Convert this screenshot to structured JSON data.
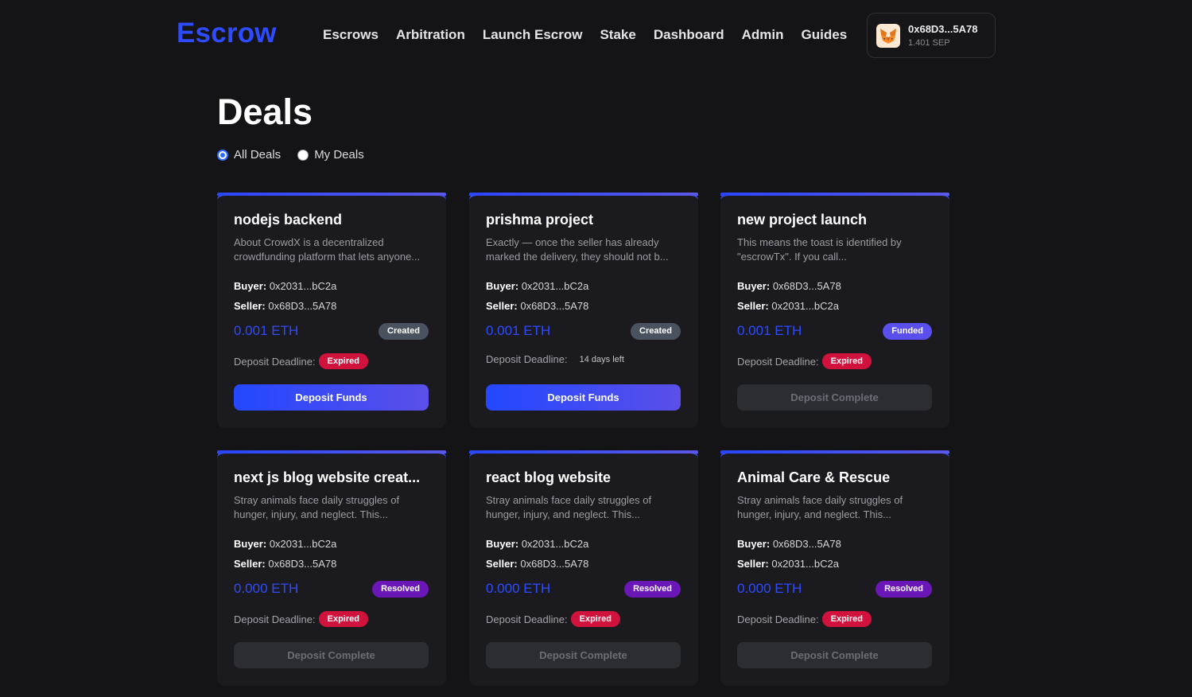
{
  "header": {
    "logo": "Escrow",
    "nav": [
      "Escrows",
      "Arbitration",
      "Launch Escrow",
      "Stake",
      "Dashboard",
      "Admin",
      "Guides"
    ],
    "wallet": {
      "address": "0x68D3...5A78",
      "balance": "1.401 SEP",
      "icon": "metamask-fox-icon"
    }
  },
  "page": {
    "title": "Deals",
    "filters": [
      {
        "label": "All Deals",
        "checked": true
      },
      {
        "label": "My Deals",
        "checked": false
      }
    ]
  },
  "labels": {
    "buyer": "Buyer:",
    "seller": "Seller:",
    "deadline": "Deposit Deadline:"
  },
  "cards": [
    {
      "title": "nodejs backend",
      "description": "About CrowdX is a decentralized crowdfunding platform that lets anyone...",
      "buyer": "0x2031...bC2a",
      "seller": "0x68D3...5A78",
      "amount": "0.001 ETH",
      "status": "Created",
      "deadline_badge": "Expired",
      "button": "Deposit Funds"
    },
    {
      "title": "prishma project",
      "description": "Exactly — once the seller has already marked the delivery, they should not b...",
      "buyer": "0x2031...bC2a",
      "seller": "0x68D3...5A78",
      "amount": "0.001 ETH",
      "status": "Created",
      "deadline_text": "14 days left",
      "button": "Deposit Funds"
    },
    {
      "title": "new project launch",
      "description": "This means the toast is identified by \"escrowTx\". If you call...",
      "buyer": "0x68D3...5A78",
      "seller": "0x2031...bC2a",
      "amount": "0.001 ETH",
      "status": "Funded",
      "deadline_badge": "Expired",
      "button": "Deposit Complete"
    },
    {
      "title": "next js blog website creat...",
      "description": "Stray animals face daily struggles of hunger, injury, and neglect. This...",
      "buyer": "0x2031...bC2a",
      "seller": "0x68D3...5A78",
      "amount": "0.000 ETH",
      "status": "Resolved",
      "deadline_badge": "Expired",
      "button": "Deposit Complete"
    },
    {
      "title": "react blog website",
      "description": "Stray animals face daily struggles of hunger, injury, and neglect. This...",
      "buyer": "0x2031...bC2a",
      "seller": "0x68D3...5A78",
      "amount": "0.000 ETH",
      "status": "Resolved",
      "deadline_badge": "Expired",
      "button": "Deposit Complete"
    },
    {
      "title": "Animal Care & Rescue",
      "description": "Stray animals face daily struggles of hunger, injury, and neglect. This...",
      "buyer": "0x68D3...5A78",
      "seller": "0x2031...bC2a",
      "amount": "0.000 ETH",
      "status": "Resolved",
      "deadline_badge": "Expired",
      "button": "Deposit Complete"
    }
  ]
}
